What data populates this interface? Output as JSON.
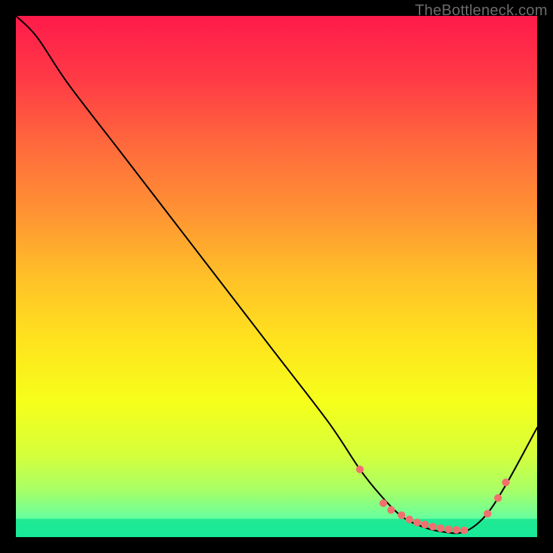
{
  "watermark": "TheBottleneck.com",
  "chart_data": {
    "type": "line",
    "title": "",
    "xlabel": "",
    "ylabel": "",
    "xlim": [
      0,
      100
    ],
    "ylim": [
      0,
      100
    ],
    "series": [
      {
        "name": "curve",
        "x": [
          0,
          4,
          10,
          20,
          30,
          40,
          50,
          60,
          66,
          70,
          74,
          78,
          82,
          86,
          90,
          94,
          100
        ],
        "y": [
          100,
          96,
          87,
          74,
          61,
          48,
          35,
          22,
          13,
          8,
          4,
          2,
          1,
          1,
          4,
          10,
          21
        ]
      }
    ],
    "markers": {
      "name": "dots",
      "color": "#f1706e",
      "points_x": [
        66,
        70.5,
        72,
        74,
        75.5,
        77,
        78.5,
        80,
        81.5,
        83,
        84.5,
        86,
        90.5,
        92.5,
        94
      ],
      "points_y": [
        13,
        6.5,
        5.2,
        4.2,
        3.4,
        2.8,
        2.4,
        2.0,
        1.7,
        1.5,
        1.4,
        1.3,
        4.5,
        7.5,
        10.5
      ]
    },
    "gradient_stops": [
      {
        "offset": 0.0,
        "color": "#ff1a4b"
      },
      {
        "offset": 0.12,
        "color": "#ff3a46"
      },
      {
        "offset": 0.25,
        "color": "#ff6a3c"
      },
      {
        "offset": 0.38,
        "color": "#ff9433"
      },
      {
        "offset": 0.5,
        "color": "#ffc028"
      },
      {
        "offset": 0.62,
        "color": "#ffe21e"
      },
      {
        "offset": 0.74,
        "color": "#f6ff1a"
      },
      {
        "offset": 0.84,
        "color": "#d6ff3a"
      },
      {
        "offset": 0.91,
        "color": "#a8ff66"
      },
      {
        "offset": 0.96,
        "color": "#6cff9a"
      },
      {
        "offset": 1.0,
        "color": "#22ffc8"
      }
    ],
    "green_band": {
      "from_y": 0,
      "to_y": 3.5,
      "color": "#15e591"
    }
  }
}
